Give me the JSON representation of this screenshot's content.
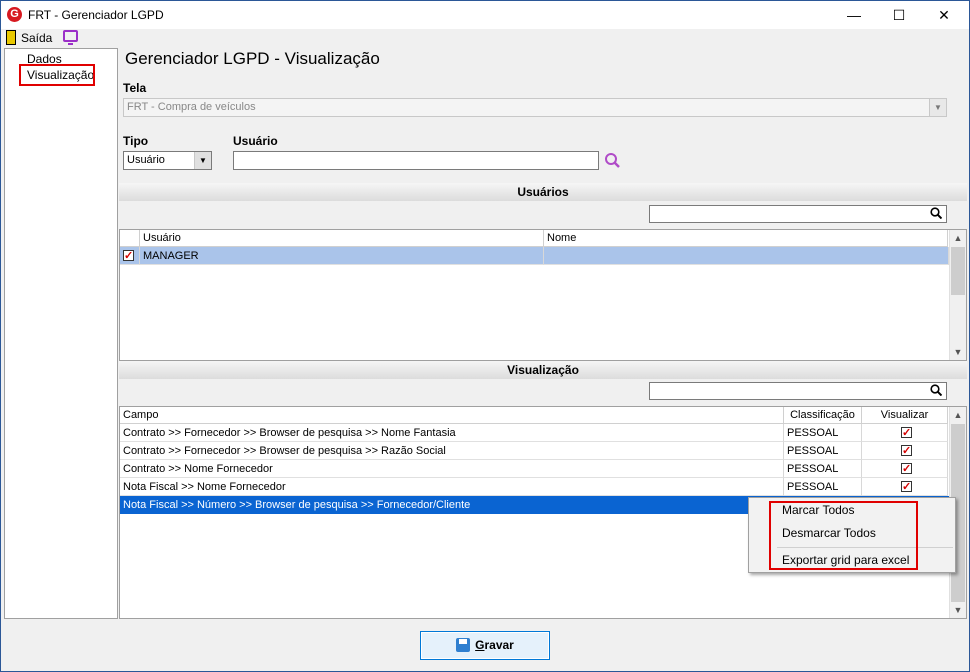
{
  "window": {
    "title": "FRT - Gerenciador LGPD",
    "app_icon": "G"
  },
  "toolbar": {
    "exit_label": "Saída"
  },
  "tree": {
    "items": [
      "Dados",
      "Visualização"
    ]
  },
  "page_title": "Gerenciador LGPD - Visualização",
  "tela": {
    "label": "Tela",
    "value": "FRT - Compra de veículos"
  },
  "tipo": {
    "label": "Tipo",
    "value": "Usuário"
  },
  "usuario_field": {
    "label": "Usuário",
    "value": ""
  },
  "usuarios_section": {
    "title": "Usuários",
    "columns": [
      "Usuário",
      "Nome"
    ],
    "rows": [
      {
        "usuario": "MANAGER",
        "nome": "",
        "checked": true
      }
    ]
  },
  "visualizacao_section": {
    "title": "Visualização",
    "columns": [
      "Campo",
      "Classificação",
      "Visualizar"
    ],
    "rows": [
      {
        "campo": "Contrato >> Fornecedor >> Browser de pesquisa >> Nome Fantasia",
        "classificacao": "PESSOAL",
        "visualizar": true
      },
      {
        "campo": "Contrato >> Fornecedor >> Browser de pesquisa >> Razão Social",
        "classificacao": "PESSOAL",
        "visualizar": true
      },
      {
        "campo": "Contrato >> Nome Fornecedor",
        "classificacao": "PESSOAL",
        "visualizar": true
      },
      {
        "campo": "Nota Fiscal  >> Nome Fornecedor",
        "classificacao": "PESSOAL",
        "visualizar": true
      },
      {
        "campo": "Nota Fiscal >> Número  >> Browser de pesquisa >> Fornecedor/Cliente",
        "classificacao": "",
        "visualizar": false
      }
    ]
  },
  "context_menu": {
    "items": [
      "Marcar Todos",
      "Desmarcar Todos",
      "Exportar grid para excel"
    ]
  },
  "save_button": {
    "label_underlined": "G",
    "label_rest": "ravar"
  },
  "colors": {
    "selection_blue": "#0a64d2",
    "highlight_red": "#e00000",
    "accent_purple": "#9b30c8"
  }
}
